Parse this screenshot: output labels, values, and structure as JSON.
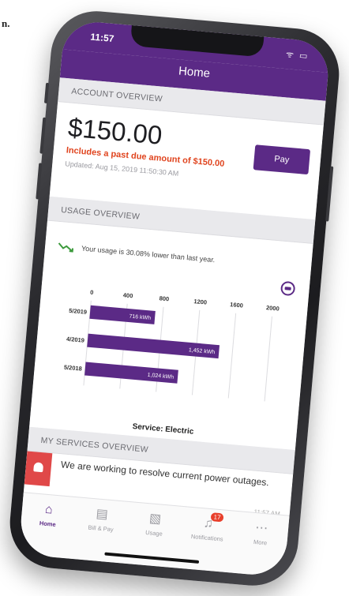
{
  "corner_fragment": "n.",
  "status_bar": {
    "time": "11:57",
    "icons": "ᯤ ▭"
  },
  "nav": {
    "title": "Home"
  },
  "account": {
    "section_title": "ACCOUNT OVERVIEW",
    "amount": "$150.00",
    "past_due": "Includes a past due amount of $150.00",
    "updated": "Updated: Aug 15, 2019 11:50:30 AM",
    "pay_label": "Pay"
  },
  "usage": {
    "section_title": "USAGE OVERVIEW",
    "trend_text": "Your usage is 30.08% lower than last year.",
    "service_label": "Service: Electric"
  },
  "chart_data": {
    "type": "bar",
    "orientation": "horizontal",
    "categories": [
      "5/2019",
      "4/2019",
      "5/2018"
    ],
    "values": [
      716,
      1452,
      1024
    ],
    "data_labels": [
      "716 kWh",
      "1,452 kWh",
      "1,024 kWh"
    ],
    "xticks": [
      "0",
      "400",
      "800",
      "1200",
      "1600",
      "2000"
    ],
    "xlim": [
      0,
      2000
    ],
    "grid": true,
    "bar_color": "#5b2a86"
  },
  "services": {
    "section_title": "MY SERVICES OVERVIEW",
    "alert_text": "We are working to resolve current power outages.",
    "alert_time": "11:57 AM"
  },
  "tabs": [
    {
      "label": "Home",
      "icon": "home-icon"
    },
    {
      "label": "Bill & Pay",
      "icon": "bill-icon"
    },
    {
      "label": "Usage",
      "icon": "usage-icon"
    },
    {
      "label": "Notifications",
      "icon": "bell-icon",
      "badge": "17"
    },
    {
      "label": "More",
      "icon": "more-icon"
    }
  ],
  "colors": {
    "brand": "#5b2a86",
    "alert": "#e04848",
    "past_due": "#e0441e"
  }
}
